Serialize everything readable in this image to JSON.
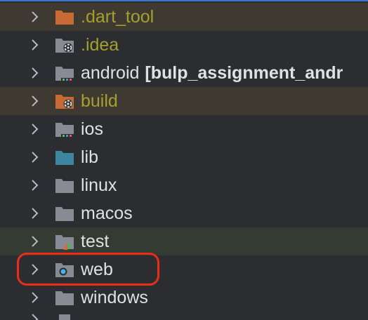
{
  "tree": {
    "rows": [
      {
        "name": ".dart_tool",
        "module": "",
        "icon": "folder-excluded-icon",
        "state": "excluded"
      },
      {
        "name": ".idea",
        "module": "",
        "icon": "folder-config-icon",
        "state": "excluded"
      },
      {
        "name": "android",
        "module": "[bulp_assignment_andr",
        "icon": "folder-module-icon",
        "state": "normal"
      },
      {
        "name": "build",
        "module": "",
        "icon": "folder-excluded-config-icon",
        "state": "excluded"
      },
      {
        "name": "ios",
        "module": "",
        "icon": "folder-module-icon",
        "state": "normal"
      },
      {
        "name": "lib",
        "module": "",
        "icon": "folder-source-icon",
        "state": "normal"
      },
      {
        "name": "linux",
        "module": "",
        "icon": "folder-icon",
        "state": "normal"
      },
      {
        "name": "macos",
        "module": "",
        "icon": "folder-icon",
        "state": "normal"
      },
      {
        "name": "test",
        "module": "",
        "icon": "folder-test-icon",
        "state": "normal"
      },
      {
        "name": "web",
        "module": "",
        "icon": "folder-web-icon",
        "state": "normal"
      },
      {
        "name": "windows",
        "module": "",
        "icon": "folder-icon",
        "state": "normal"
      }
    ]
  },
  "colors": {
    "background": "#2b2d30",
    "excluded_row": "#3f3a31",
    "test_row": "#333b33",
    "excluded_text": "#a5a02e",
    "text": "#dfe1e5",
    "highlight": "#ec2b19",
    "folder_gray": "#868b94",
    "folder_orange": "#c76a34",
    "folder_blue": "#3e86a0"
  }
}
